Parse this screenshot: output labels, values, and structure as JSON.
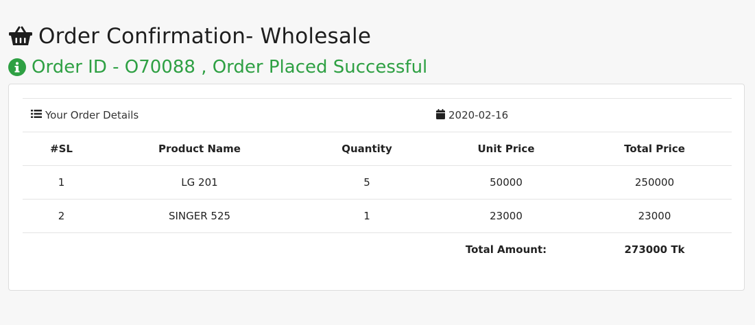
{
  "header": {
    "title": "Order Confirmation- Wholesale",
    "title_icon": "basket-icon",
    "status": "Order ID - O70088 , Order Placed Successful",
    "status_icon": "info-circle-icon",
    "status_color": "#2ea043"
  },
  "order": {
    "details_label": "Your Order Details",
    "details_icon": "list-icon",
    "date": "2020-02-16",
    "date_icon": "calendar-icon",
    "columns": [
      "#SL",
      "Product Name",
      "Quantity",
      "Unit Price",
      "Total Price"
    ],
    "rows": [
      {
        "sl": "1",
        "name": "LG 201",
        "qty": "5",
        "unit": "50000",
        "total": "250000"
      },
      {
        "sl": "2",
        "name": "SINGER 525",
        "qty": "1",
        "unit": "23000",
        "total": "23000"
      }
    ],
    "total_label": "Total Amount:",
    "total_value": "273000 Tk"
  }
}
